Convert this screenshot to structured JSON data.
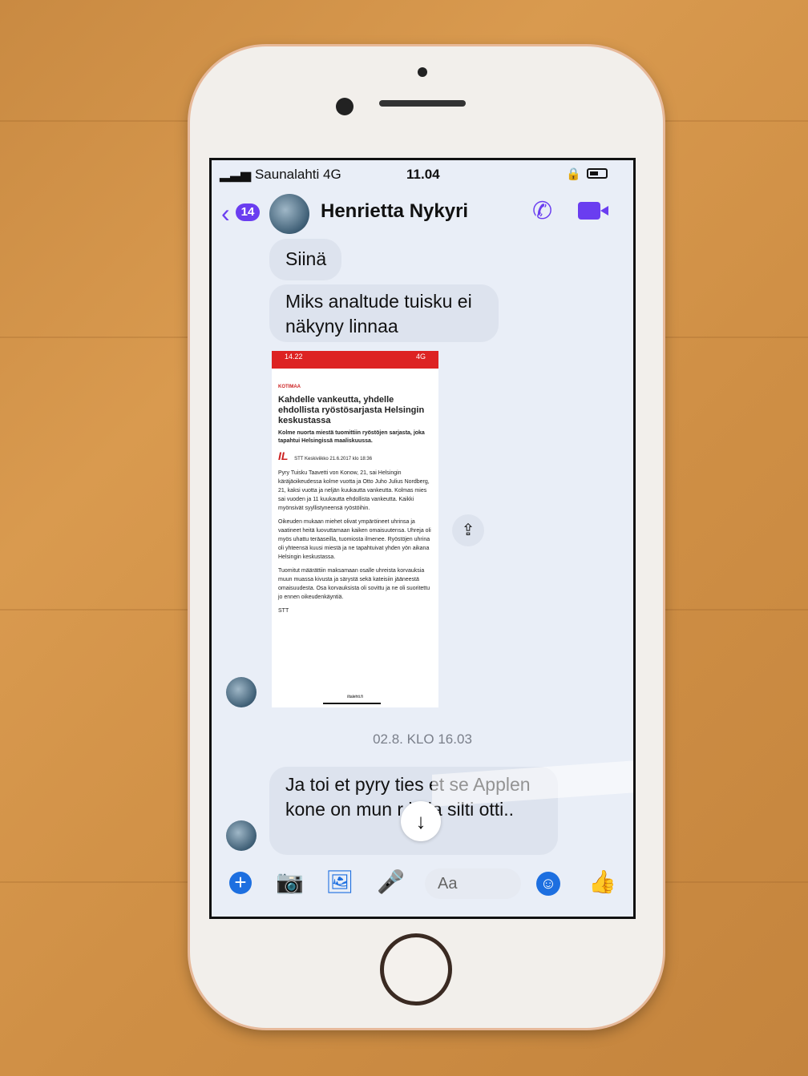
{
  "status_bar": {
    "carrier": "Saunalahti",
    "network": "4G",
    "time": "11.04"
  },
  "header": {
    "unread_badge": "14",
    "contact_name": "Henrietta Nykyri"
  },
  "messages": [
    {
      "text": "Siinä"
    },
    {
      "text": "Miks analtude tuisku ei näkyny linnaa"
    }
  ],
  "article": {
    "phone_time": "14.22",
    "phone_network": "4G",
    "category": "KOTIMAA",
    "title": "Kahdelle vankeutta, yhdelle ehdollista ryöstösarjasta Helsingin keskustassa",
    "lead": "Kolme nuorta miestä tuomittiin ryöstöjen sarjasta, joka tapahtui Helsingissä maaliskuussa.",
    "logo": "IL",
    "source": "STT",
    "date": "Keskiviikko 21.6.2017 klo 18:36",
    "paragraphs": [
      "Pyry Tuisku Taavetti von Konow, 21, sai Helsingin käräjäoikeudessa kolme vuotta ja Otto Juho Julius Nordberg, 21, kaksi vuotta ja neljän kuukautta vankeutta. Kolmas mies sai vuoden ja 11 kuukautta ehdollista vankeutta. Kaikki myönsivät syyllistyneensä ryöstöihin.",
      "Oikeuden mukaan miehet olivat ympäröineet uhrinsa ja vaatineet heitä luovuttamaan kaiken omaisuutensa. Uhreja oli myös uhattu teräaseilla, tuomiosta ilmenee. Ryöstöjen uhrina oli yhteensä kuusi miestä ja ne tapahtuivat yhden yön aikana Helsingin keskustassa.",
      "Tuomitut määrättiin maksamaan osalle uhreista korvauksia muun muassa kivusta ja särystä sekä kateisiin jääneestä omaisuudesta. Osa korvauksista oli sovittu ja ne oli suoritettu jo ennen oikeudenkäyntiä.",
      "STT"
    ],
    "footer_url": "iltalehti.fi"
  },
  "timestamp": "02.8. KLO 16.03",
  "last_message": {
    "text": "Ja toi et pyry ties et se Applen kone on mun r    in ja silti otti.."
  },
  "composer": {
    "placeholder": "Aa"
  },
  "icons": [
    "back-chevron-icon",
    "phone-icon",
    "video-icon",
    "share-icon",
    "scroll-down-icon",
    "plus-icon",
    "camera-icon",
    "image-icon",
    "microphone-icon",
    "emoji-icon",
    "thumbs-up-icon"
  ],
  "colors": {
    "accent_purple": "#6a3df0",
    "accent_blue": "#1d6fe0",
    "bubble": "#dde3ee"
  }
}
